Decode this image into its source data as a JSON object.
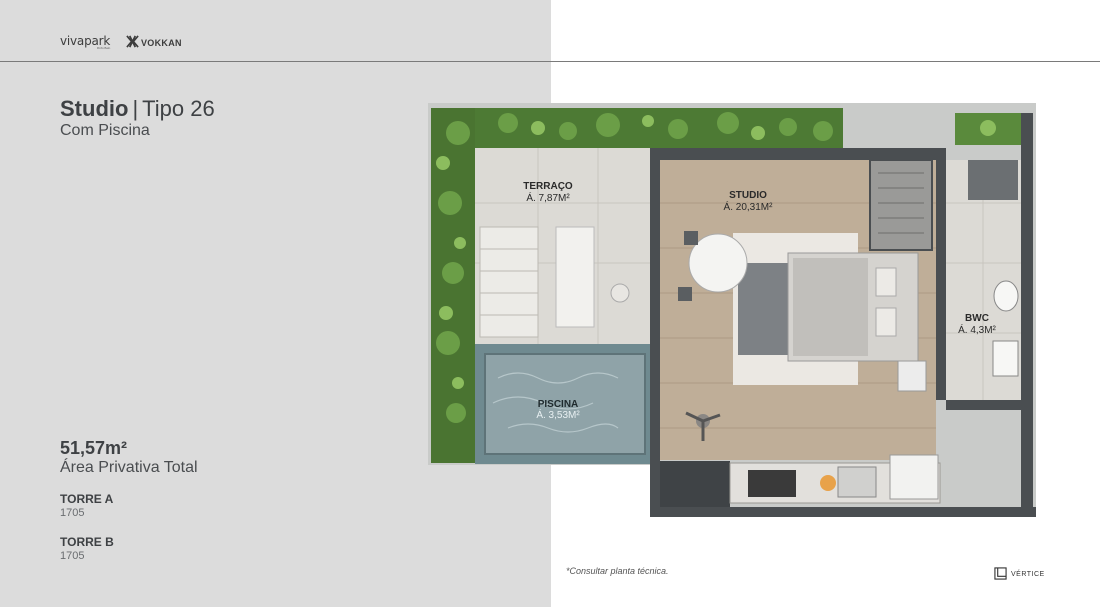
{
  "brand": {
    "vivapark": "vivapark",
    "vivapark_sub": "Porto Belo",
    "vokkan": "VOKKAN",
    "vertice": "VÉRTICE"
  },
  "unit": {
    "name": "Studio",
    "type": "Tipo 26",
    "subtitle": "Com Piscina",
    "area": "51,57m²",
    "area_label": "Área Privativa Total"
  },
  "towers": [
    {
      "name": "TORRE A",
      "unit": "1705"
    },
    {
      "name": "TORRE B",
      "unit": "1705"
    }
  ],
  "rooms": {
    "terraco": {
      "name": "TERRAÇO",
      "area": "Á. 7,87M²"
    },
    "studio": {
      "name": "STUDIO",
      "area": "Á. 20,31M²"
    },
    "bwc": {
      "name": "BWC",
      "area": "Á. 4,3M²"
    },
    "piscina": {
      "name": "PISCINA",
      "area": "Á. 3,53M²"
    }
  },
  "note": "*Consultar planta técnica.",
  "colors": {
    "left_panel": "#dcdcdc",
    "wall": "#4a4e51",
    "wood_floor": "#bfae98",
    "tile_floor": "#dcdad5",
    "pool_water": "#8fa3a8",
    "garden": "#4d7a34"
  },
  "icons": [
    "vokkan-logo-icon",
    "vertice-logo-icon"
  ]
}
